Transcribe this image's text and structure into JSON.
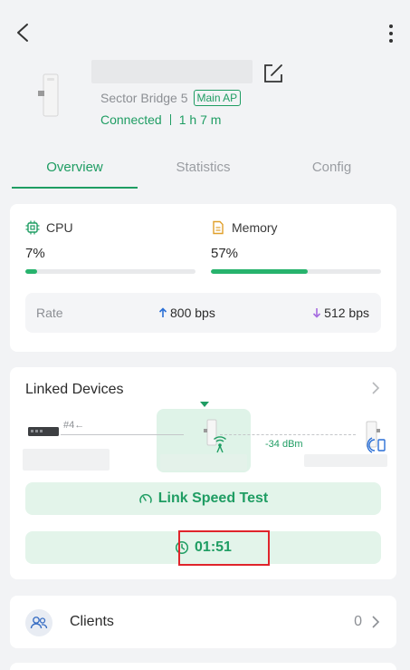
{
  "device": {
    "model": "Sector Bridge 5",
    "role_badge": "Main AP",
    "status": "Connected",
    "uptime": "1 h 7 m"
  },
  "tabs": [
    {
      "label": "Overview",
      "active": true
    },
    {
      "label": "Statistics",
      "active": false
    },
    {
      "label": "Config",
      "active": false
    }
  ],
  "resources": {
    "cpu": {
      "label": "CPU",
      "value": "7%",
      "percent": 7
    },
    "memory": {
      "label": "Memory",
      "value": "57%",
      "percent": 57
    }
  },
  "rate": {
    "label": "Rate",
    "up": "800 bps",
    "down": "512 bps"
  },
  "linked_devices": {
    "title": "Linked Devices",
    "port_label": "#4←",
    "signal": "-34 dBm"
  },
  "buttons": {
    "link_speed_test": "Link Speed Test",
    "timer": "01:51"
  },
  "clients": {
    "label": "Clients",
    "count": "0"
  },
  "colors": {
    "accent": "#1f9d63",
    "bar_fill": "#27b36d",
    "highlight_box": "#e0242b"
  }
}
